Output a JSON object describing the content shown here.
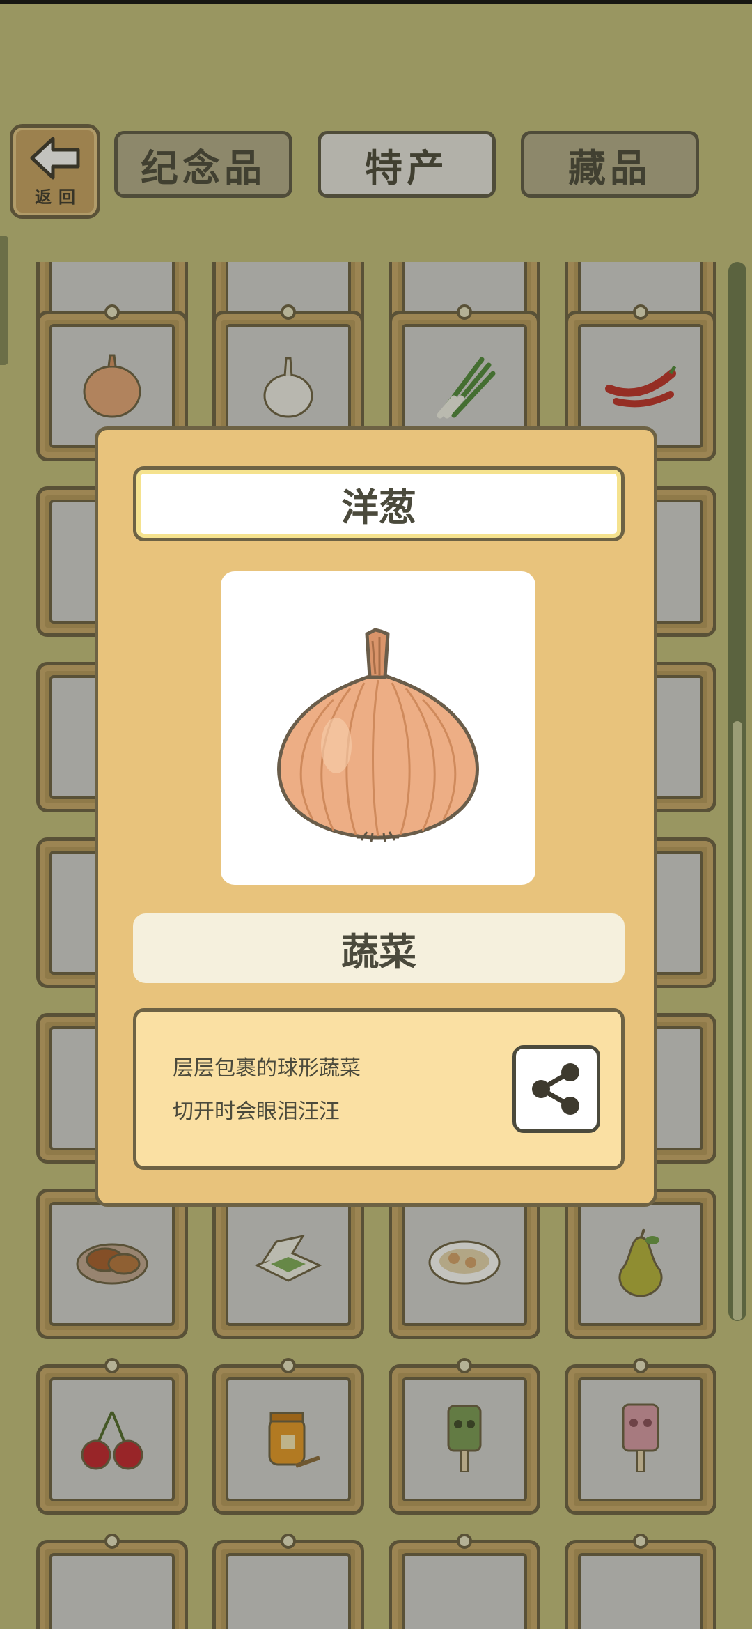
{
  "header": {
    "back_label": "返回",
    "tabs": [
      {
        "label": "纪念品",
        "active": false
      },
      {
        "label": "特产",
        "active": true
      },
      {
        "label": "藏品",
        "active": false
      }
    ]
  },
  "grid": {
    "visible_items": [
      "onion-icon",
      "garlic-icon",
      "scallion-icon",
      "chili-pepper-icon",
      "pie-icon",
      "bento-box-icon",
      "dumplings-icon",
      "pear-icon",
      "cherries-icon",
      "honey-jar-icon",
      "bronze-mask-skewer-icon",
      "totem-popsicle-icon"
    ]
  },
  "detail": {
    "name": "洋葱",
    "image_icon": "onion-icon",
    "category": "蔬菜",
    "description_lines": [
      "层层包裹的球形蔬菜",
      "切开时会眼泪汪汪"
    ],
    "share_icon": "share-icon"
  },
  "colors": {
    "background": "#c5c17f",
    "card_frame": "#b89a5e",
    "modal_bg": "#e8c37c",
    "description_bg": "#fae0a3",
    "outline": "#6d6244"
  }
}
